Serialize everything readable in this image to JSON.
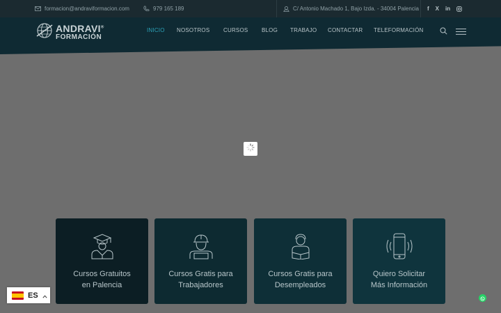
{
  "topbar": {
    "email": "formacion@andraviformacion.com",
    "phone": "979 165 189",
    "address": "C/ Antonio Machado 1, Bajo Izda. - 34004 Palencia",
    "social": [
      {
        "icon": "facebook-icon",
        "label": "f"
      },
      {
        "icon": "x-twitter-icon",
        "label": "X"
      },
      {
        "icon": "linkedin-icon",
        "label": "in"
      },
      {
        "icon": "instagram-icon",
        "label": "ig"
      }
    ]
  },
  "logo": {
    "line1": "ANDRAVI",
    "registered": "®",
    "line2": "FORMACIÓN"
  },
  "nav": {
    "items": [
      "INICIO",
      "NOSOTROS",
      "CURSOS",
      "BLOG",
      "TRABAJO",
      "CONTACTAR",
      "TELEFORMACIÓN"
    ],
    "active": "INICIO",
    "search_icon": "search-icon",
    "menu_icon": "hamburger-menu-icon"
  },
  "cards": [
    {
      "icon": "graduate-icon",
      "line1": "Cursos Gratuitos",
      "line2": "en Palencia"
    },
    {
      "icon": "worker-helmet-icon",
      "line1": "Cursos Gratis para",
      "line2": "Trabajadores"
    },
    {
      "icon": "reader-book-icon",
      "line1": "Cursos Gratis para",
      "line2": "Desempleados"
    },
    {
      "icon": "ringing-phone-icon",
      "line1": "Quiero Solicitar",
      "line2": "Más Información"
    }
  ],
  "language": {
    "code": "ES",
    "flag_icon": "spain-flag-icon"
  },
  "colors": {
    "topbar": "#1b2a30",
    "nav": "#0f2a33",
    "accent": "#2ca2b8",
    "overlay": "#6e6e6e",
    "card_dark": "#0c1e24",
    "card_teal": "#0f343d",
    "whatsapp": "#25d366"
  }
}
